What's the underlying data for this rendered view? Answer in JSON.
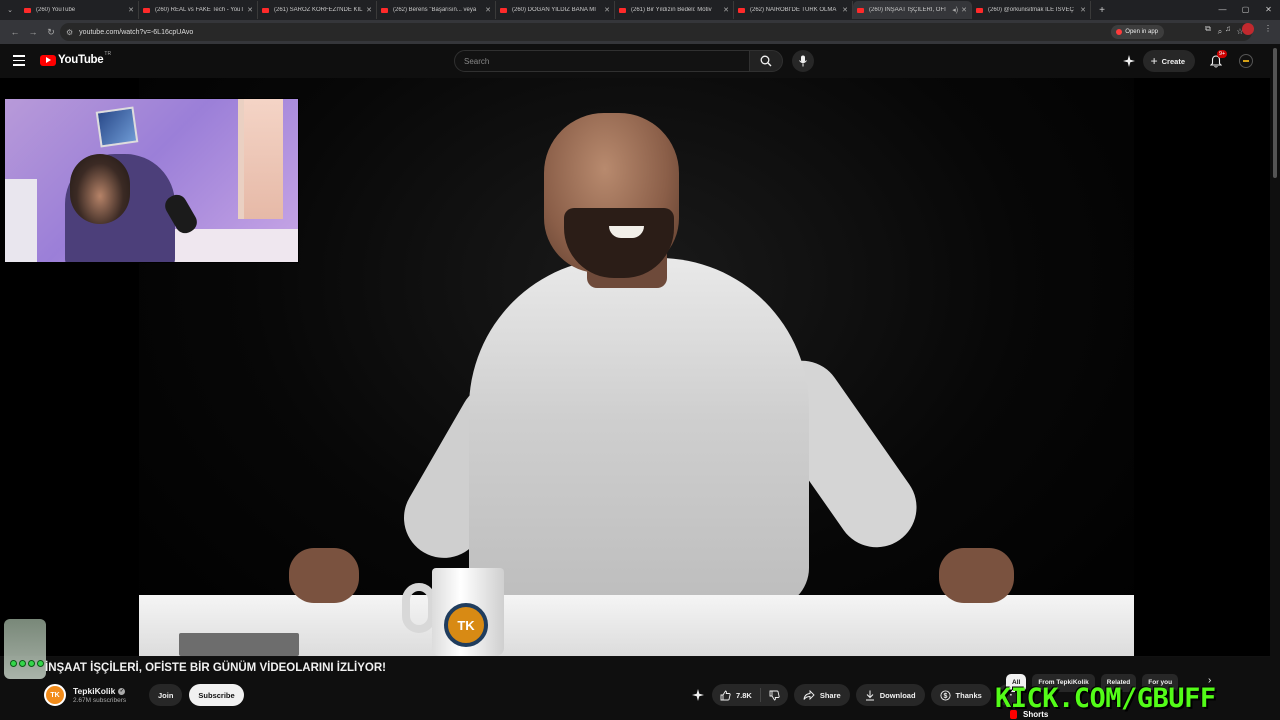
{
  "browser": {
    "tabs": [
      {
        "title": "(260) YouTube",
        "active": false
      },
      {
        "title": "(260) REAL vs FAKE Tech - YouT",
        "active": false
      },
      {
        "title": "(261) SAROZ KÖRFEZİ'NDE KIL",
        "active": false
      },
      {
        "title": "(262) Berens \"Başarısın... veya",
        "active": false
      },
      {
        "title": "(260) DOĞAN YILDIZ BANA MI",
        "active": false
      },
      {
        "title": "(261) Bir Yıldızın Bedeli: Motiv",
        "active": false
      },
      {
        "title": "(262) NAIROBI'DE TÜRK OLMA",
        "active": false
      },
      {
        "title": "(260) İNŞAAT İŞÇİLERİ, OFİ",
        "active": true
      },
      {
        "title": "(260) @orkunisitmak İLE İSVEÇ",
        "active": false
      }
    ],
    "url": "youtube.com/watch?v=-6L16cpUAvo",
    "open_in_app": "Open in app"
  },
  "header": {
    "logo_text": "YouTube",
    "country_code": "TR",
    "search_placeholder": "Search",
    "create_label": "Create",
    "notifications_badge": "9+"
  },
  "video": {
    "title": "İNŞAAT İŞÇİLERİ, OFİSTE BİR GÜNÜM VİDEOLARINI İZLİYOR!",
    "mug_logo": "TK"
  },
  "channel": {
    "avatar_text": "TK",
    "name": "TepkiKolik",
    "subscribers": "2.67M subscribers",
    "join_label": "Join",
    "subscribe_label": "Subscribe"
  },
  "actions": {
    "likes": "7.8K",
    "share_label": "Share",
    "download_label": "Download",
    "thanks_label": "Thanks"
  },
  "chips": [
    {
      "label": "All",
      "active": true
    },
    {
      "label": "From TepkiKolik",
      "active": false
    },
    {
      "label": "Related",
      "active": false
    },
    {
      "label": "For you",
      "active": false
    }
  ],
  "overlay": {
    "kick_text": "KICK.COM/GBUFF"
  },
  "sidebar": {
    "shorts_label": "Shorts"
  },
  "colors": {
    "youtube_red": "#ff0000",
    "kick_green": "#53fc18",
    "background": "#0f0f0f"
  }
}
